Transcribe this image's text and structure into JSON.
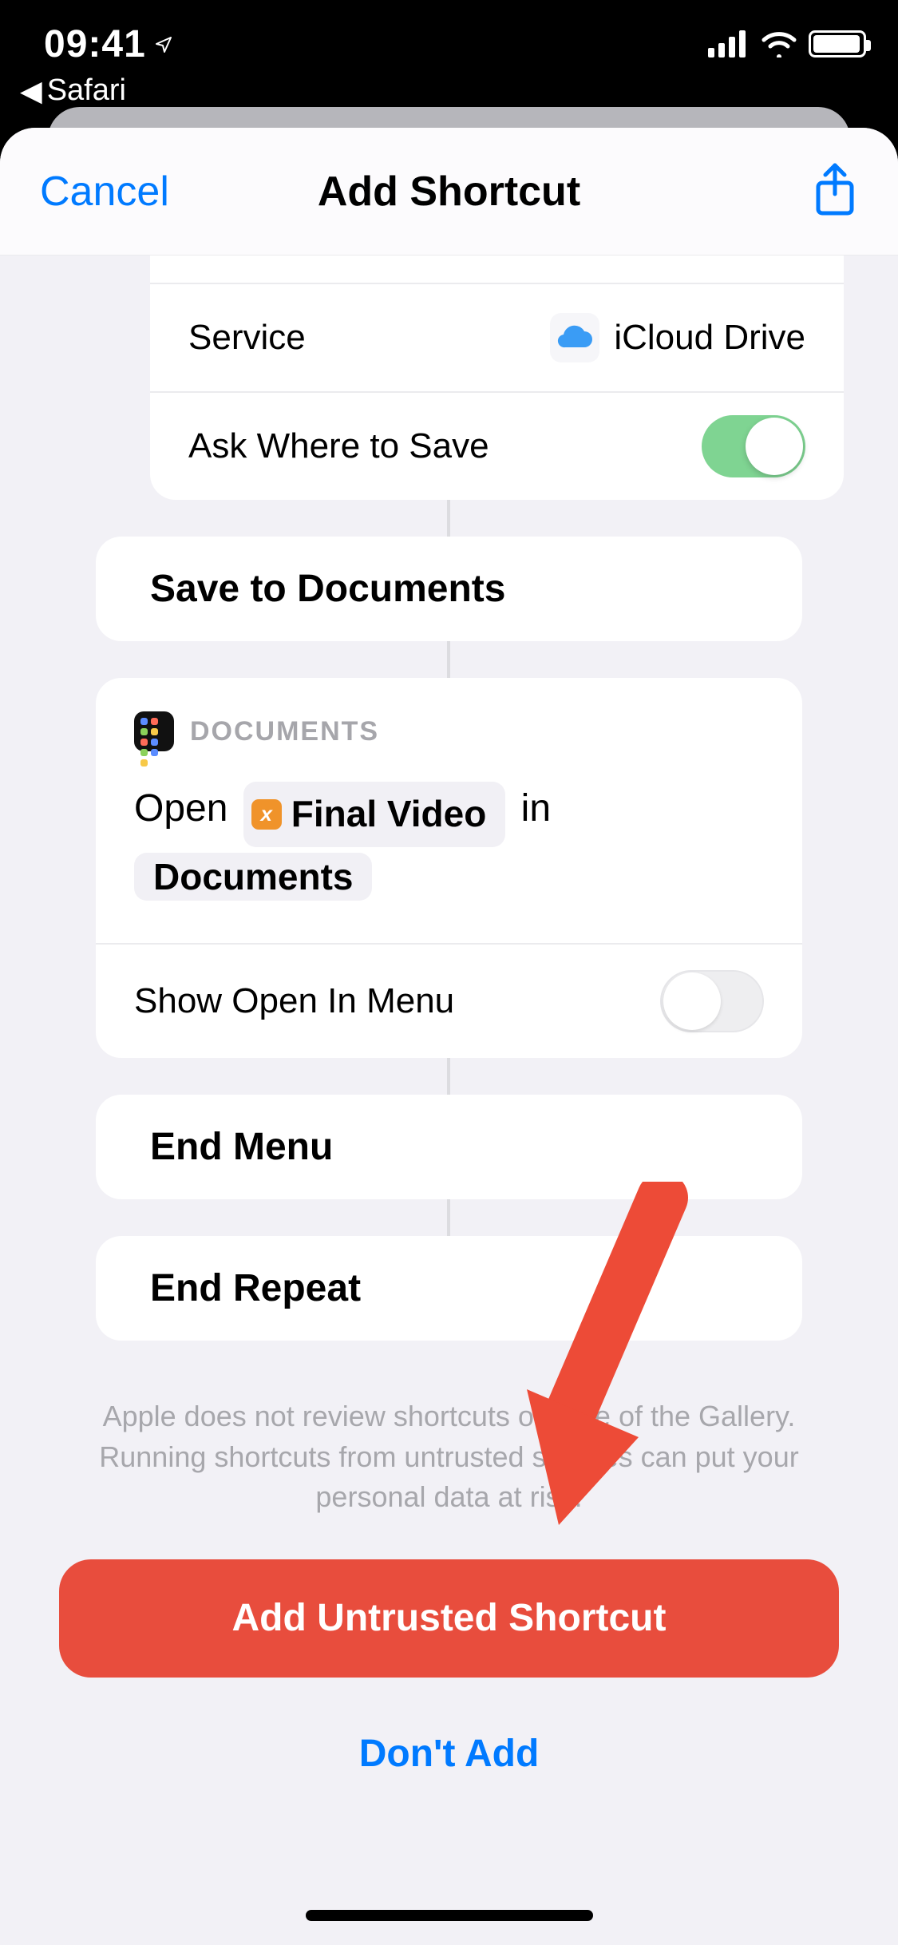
{
  "statusbar": {
    "time": "09:41",
    "back_label": "Safari"
  },
  "nav": {
    "cancel": "Cancel",
    "title": "Add Shortcut"
  },
  "service_row": {
    "label": "Service",
    "value": "iCloud Drive"
  },
  "ask_row": {
    "label": "Ask Where to Save",
    "on": true
  },
  "save_action": {
    "label": "Save to Documents"
  },
  "documents_action": {
    "header": "DOCUMENTS",
    "body_pre": "Open ",
    "var_label": "Final Video",
    "body_mid": " in",
    "app_label": "Documents",
    "menu_label": "Show Open In Menu",
    "menu_on": false
  },
  "end_menu": {
    "label": "End Menu"
  },
  "end_repeat": {
    "label": "End Repeat"
  },
  "warning_text": "Apple does not review shortcuts outside of the Gallery. Running shortcuts from untrusted sources can put your personal data at risk.",
  "add_button": "Add Untrusted Shortcut",
  "dont_add": "Don't Add"
}
